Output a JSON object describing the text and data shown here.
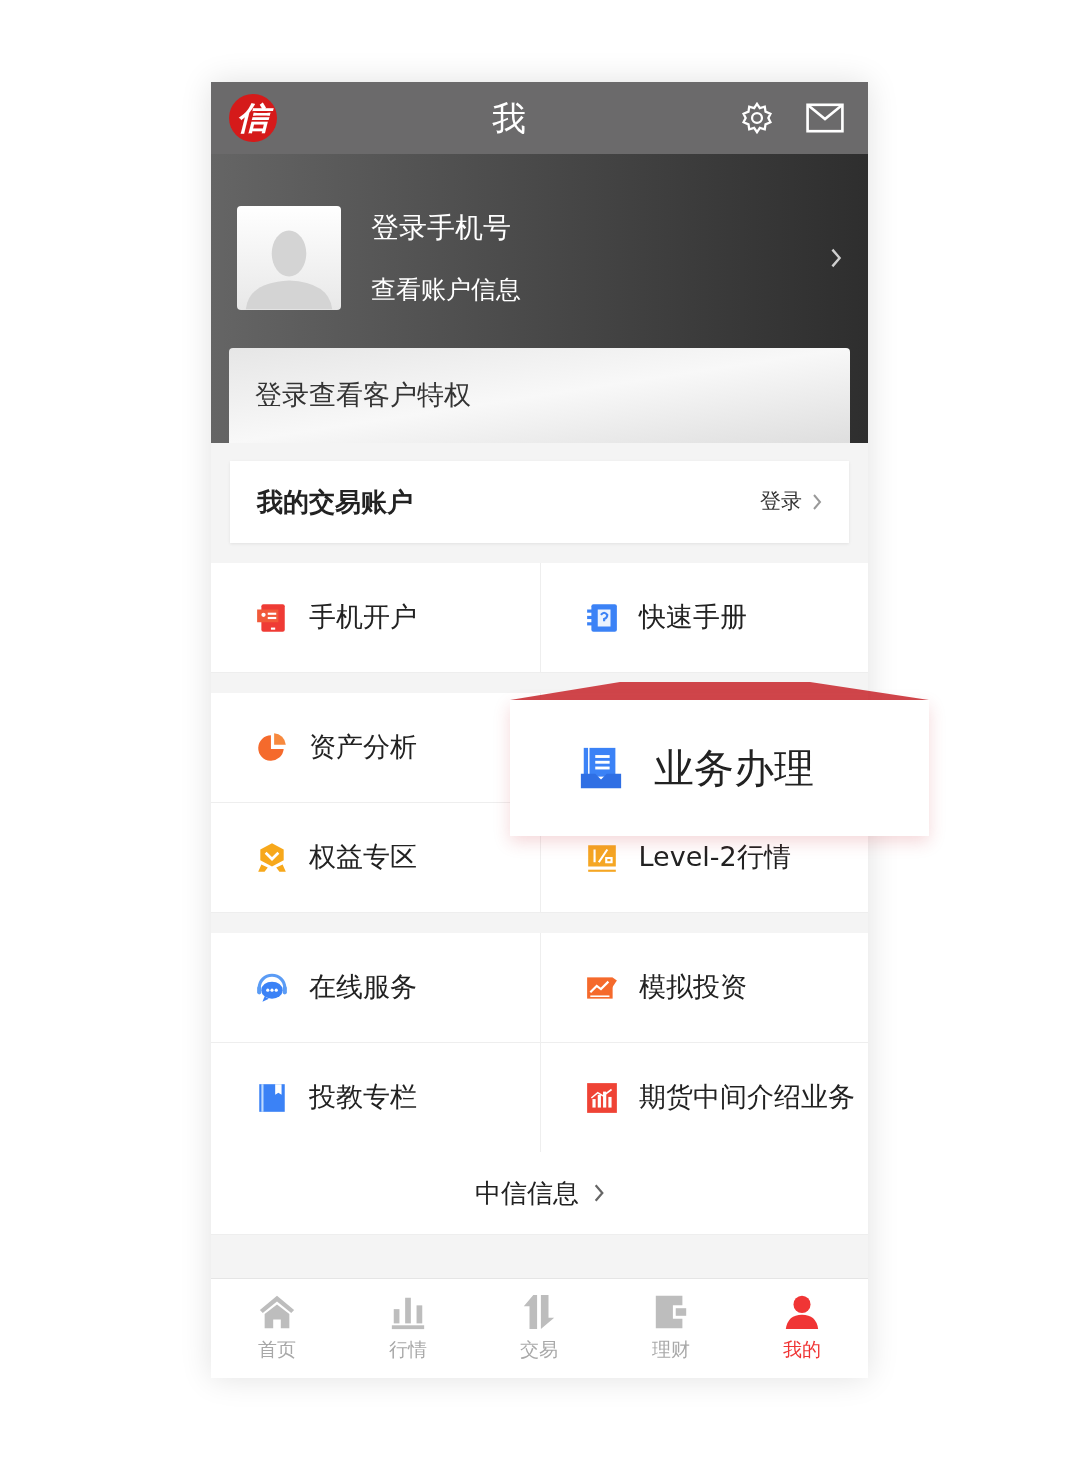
{
  "header": {
    "logo": "信",
    "title": "我"
  },
  "profile": {
    "name": "登录手机号",
    "subtitle": "查看账户信息"
  },
  "privilege_banner": {
    "text": "登录查看客户特权"
  },
  "account": {
    "title": "我的交易账户",
    "action": "登录"
  },
  "groups": [
    {
      "items": [
        {
          "label": "手机开户",
          "highlighted": false
        },
        {
          "label": "快速手册",
          "highlighted": false
        }
      ]
    },
    {
      "items": [
        {
          "label": "资产分析",
          "highlighted": false
        },
        {
          "label": "业务办理",
          "highlighted": true
        },
        {
          "label": "权益专区",
          "highlighted": false
        },
        {
          "label": "Level-2行情",
          "highlighted": false
        }
      ]
    },
    {
      "items": [
        {
          "label": "在线服务",
          "highlighted": false
        },
        {
          "label": "模拟投资",
          "highlighted": false
        },
        {
          "label": "投教专栏",
          "highlighted": false
        },
        {
          "label": "期货中间介绍业务",
          "highlighted": false
        }
      ]
    }
  ],
  "info_link": {
    "label": "中信信息"
  },
  "tab_bar": [
    {
      "label": "首页",
      "selected": false
    },
    {
      "label": "行情",
      "selected": false
    },
    {
      "label": "交易",
      "selected": false
    },
    {
      "label": "理财",
      "selected": false
    },
    {
      "label": "我的",
      "selected": true
    }
  ]
}
